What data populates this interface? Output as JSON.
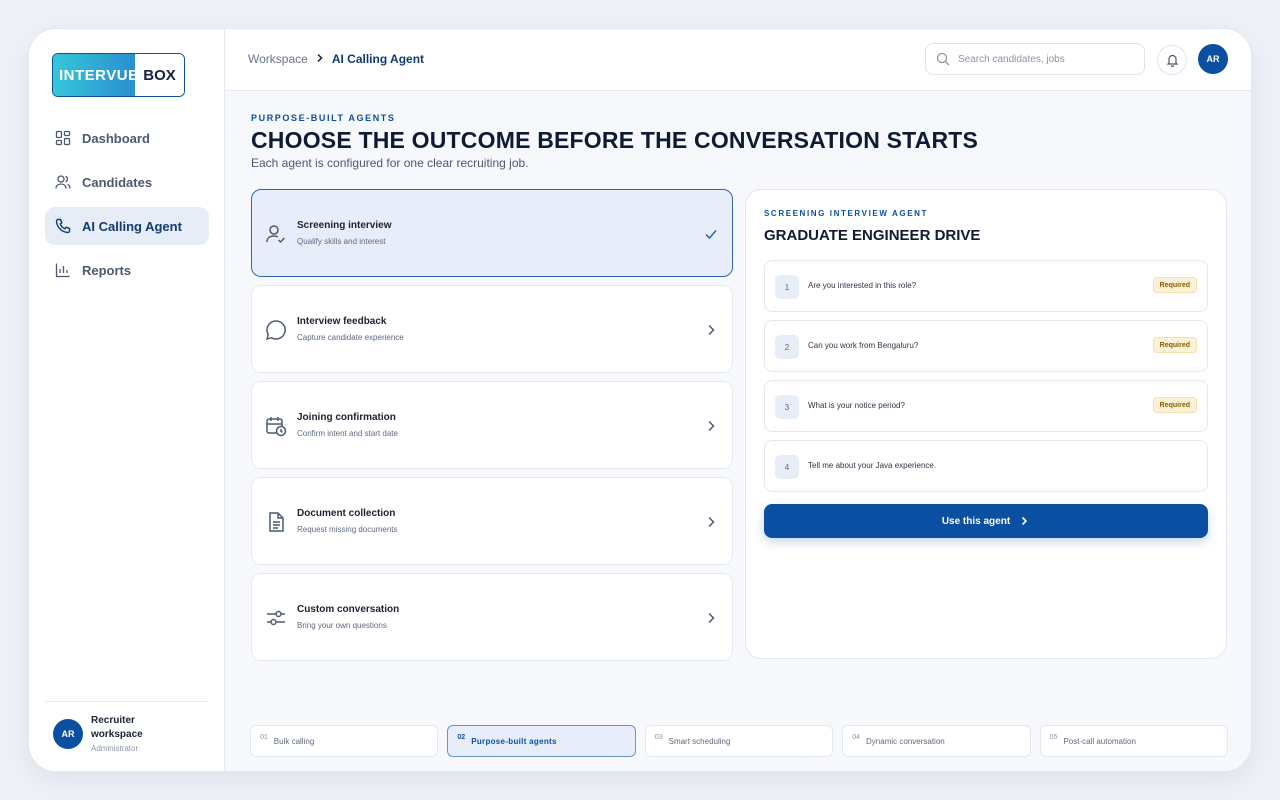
{
  "brand": {
    "logo_left": "INTERVUE",
    "logo_right": "BOX"
  },
  "sidebar": {
    "items": [
      {
        "label": "Dashboard",
        "icon": "dashboard-icon"
      },
      {
        "label": "Candidates",
        "icon": "users-icon"
      },
      {
        "label": "AI Calling Agent",
        "icon": "phone-icon",
        "active": true
      },
      {
        "label": "Reports",
        "icon": "bar-chart-icon"
      }
    ],
    "user": {
      "initials": "AR",
      "name": "Recruiter workspace",
      "role": "Administrator"
    }
  },
  "header": {
    "breadcrumb": [
      "Workspace",
      "AI Calling Agent"
    ],
    "search_placeholder": "Search candidates, jobs",
    "avatar_initials": "AR"
  },
  "main": {
    "eyebrow": "PURPOSE-BUILT AGENTS",
    "title": "CHOOSE THE OUTCOME BEFORE THE CONVERSATION STARTS",
    "subtitle": "Each agent is configured for one clear recruiting job.",
    "agents": [
      {
        "name": "Screening interview",
        "desc": "Qualify skills and interest",
        "icon": "user-check-icon",
        "selected": true
      },
      {
        "name": "Interview feedback",
        "desc": "Capture candidate experience",
        "icon": "chat-bubble-icon"
      },
      {
        "name": "Joining confirmation",
        "desc": "Confirm intent and start date",
        "icon": "calendar-clock-icon"
      },
      {
        "name": "Document collection",
        "desc": "Request missing documents",
        "icon": "document-icon"
      },
      {
        "name": "Custom conversation",
        "desc": "Bring your own questions",
        "icon": "sliders-icon"
      }
    ]
  },
  "panel": {
    "eyebrow": "SCREENING INTERVIEW AGENT",
    "title": "GRADUATE ENGINEER DRIVE",
    "questions": [
      {
        "num": "1",
        "text": "Are you interested in this role?",
        "badge": "Required"
      },
      {
        "num": "2",
        "text": "Can you work from Bengaluru?",
        "badge": "Required"
      },
      {
        "num": "3",
        "text": "What is your notice period?",
        "badge": "Required"
      },
      {
        "num": "4",
        "text": "Tell me about your Java experience.",
        "badge": ""
      }
    ],
    "cta": "Use this agent"
  },
  "steps": [
    {
      "num": "01",
      "label": "Bulk calling"
    },
    {
      "num": "02",
      "label": "Purpose-built agents",
      "active": true
    },
    {
      "num": "03",
      "label": "Smart scheduling"
    },
    {
      "num": "04",
      "label": "Dynamic conversation"
    },
    {
      "num": "05",
      "label": "Post-call automation"
    }
  ],
  "colors": {
    "primary": "#0b4fa3",
    "selected_bg": "#e7eef9",
    "badge_bg": "#fdf1d8"
  }
}
